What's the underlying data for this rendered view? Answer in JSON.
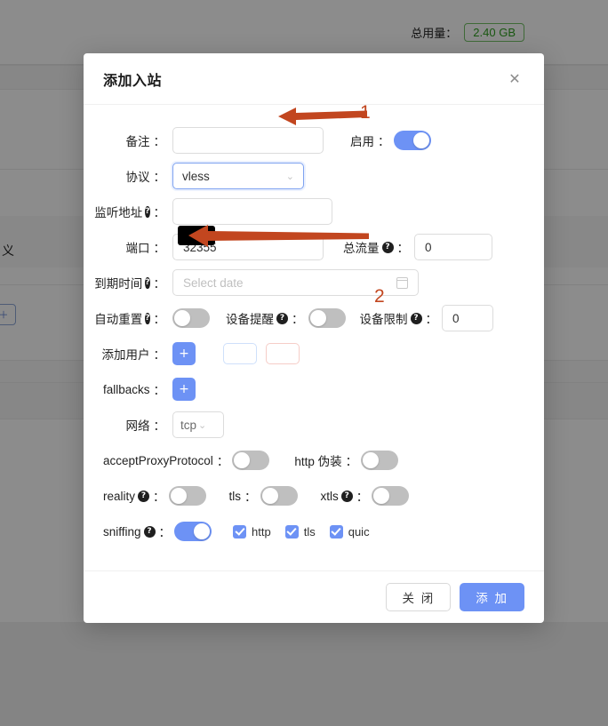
{
  "background": {
    "total_label": "总用量：",
    "total_value": "2.40 GB",
    "total_value_color": "#2f9e20",
    "partial_text": "义"
  },
  "modal": {
    "title": "添加入站",
    "close_icon": "close-icon",
    "fields": {
      "remark": {
        "label": "备注",
        "colon": "：",
        "value": "",
        "placeholder": ""
      },
      "enable": {
        "label": "启用",
        "colon": "：",
        "on": true
      },
      "protocol": {
        "label": "协议",
        "colon": "：",
        "value": "vless",
        "focused": true
      },
      "listen_addr": {
        "label": "监听地址",
        "colon": "：",
        "help": "?",
        "value": ""
      },
      "port": {
        "label": "端口",
        "colon": "：",
        "value": "32355"
      },
      "total_flow": {
        "label": "总流量",
        "colon": "：",
        "help": "?",
        "value": "0"
      },
      "expiry": {
        "label": "到期时间",
        "colon": "：",
        "help": "?",
        "placeholder": "Select date"
      },
      "auto_reset": {
        "label": "自动重置",
        "colon": "：",
        "help": "?",
        "on": false
      },
      "device_alert": {
        "label": "设备提醒",
        "colon": "：",
        "help": "?",
        "on": false
      },
      "device_limit": {
        "label": "设备限制",
        "colon": "：",
        "help": "?",
        "value": "0"
      },
      "add_user": {
        "label": "添加用户",
        "colon": "：",
        "plus": "+",
        "ghost_blue": "",
        "ghost_red": ""
      },
      "fallbacks": {
        "label": "fallbacks",
        "colon": "：",
        "plus": "+"
      },
      "network": {
        "label": "网络",
        "colon": "：",
        "value": "tcp"
      },
      "accept_proxy_protocol": {
        "label": "acceptProxyProtocol",
        "colon": "：",
        "on": false
      },
      "http_disguise": {
        "label": "http 伪装",
        "colon": "：",
        "on": false
      },
      "reality": {
        "label": "reality",
        "colon": "：",
        "help": "?",
        "on": false
      },
      "tls": {
        "label": "tls",
        "colon": "：",
        "on": false
      },
      "xtls": {
        "label": "xtls",
        "colon": "：",
        "help": "?",
        "on": false
      },
      "sniffing": {
        "label": "sniffing",
        "colon": "：",
        "help": "?",
        "on": true
      },
      "sniff_http": {
        "label": "http",
        "checked": true
      },
      "sniff_tls": {
        "label": "tls",
        "checked": true
      },
      "sniff_quic": {
        "label": "quic",
        "checked": true
      }
    },
    "footer": {
      "close_label": "关 闭",
      "submit_label": "添 加"
    }
  },
  "annotations": {
    "color": "#c2461f",
    "marker_1": "1",
    "marker_2": "2"
  },
  "theme": {
    "accent": "#6d92f5",
    "toggle_off": "#bfbfbf",
    "annotation": "#c2461f",
    "success_green": "#2f9e20"
  }
}
